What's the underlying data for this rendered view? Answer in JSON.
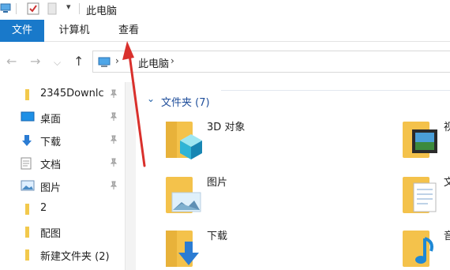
{
  "titlebar": {
    "title": "此电脑",
    "dropdown_glyph": "▾",
    "icons": [
      "computer-icon",
      "properties-check-icon",
      "new-folder-icon"
    ]
  },
  "ribbon": {
    "tabs": [
      {
        "label": "文件",
        "active": true
      },
      {
        "label": "计算机",
        "active": false
      },
      {
        "label": "查看",
        "active": false
      }
    ],
    "accent_color": "#1979ca"
  },
  "address": {
    "back_glyph": "←",
    "forward_glyph": "→",
    "dropdown_glyph": "⌵",
    "up_glyph": "↑",
    "chevron": "›",
    "path": [
      "此电脑"
    ]
  },
  "navpane": {
    "items": [
      {
        "label": "2345Downlc",
        "icon": "folder-icon",
        "pinned": true
      },
      {
        "label": "桌面",
        "icon": "desktop-icon",
        "pinned": true
      },
      {
        "label": "下载",
        "icon": "download-icon",
        "pinned": true
      },
      {
        "label": "文档",
        "icon": "document-icon",
        "pinned": true
      },
      {
        "label": "图片",
        "icon": "pictures-icon",
        "pinned": true
      },
      {
        "label": "2",
        "icon": "folder-icon",
        "pinned": false
      },
      {
        "label": "配图",
        "icon": "folder-icon",
        "pinned": false
      },
      {
        "label": "新建文件夹 (2)",
        "icon": "folder-icon",
        "pinned": false
      }
    ]
  },
  "content": {
    "group_chevron": "⌄",
    "group_title": "文件夹 (7)",
    "folders": [
      {
        "name": "3D 对象",
        "icon": "3d-objects-folder-icon"
      },
      {
        "name": "视",
        "icon": "videos-folder-icon"
      },
      {
        "name": "图片",
        "icon": "pictures-folder-icon"
      },
      {
        "name": "文",
        "icon": "documents-folder-icon"
      },
      {
        "name": "下载",
        "icon": "downloads-folder-icon"
      },
      {
        "name": "音",
        "icon": "music-folder-icon"
      }
    ]
  },
  "annotation": {
    "color": "#d9302c",
    "icon": "red-arrow-annotation"
  }
}
